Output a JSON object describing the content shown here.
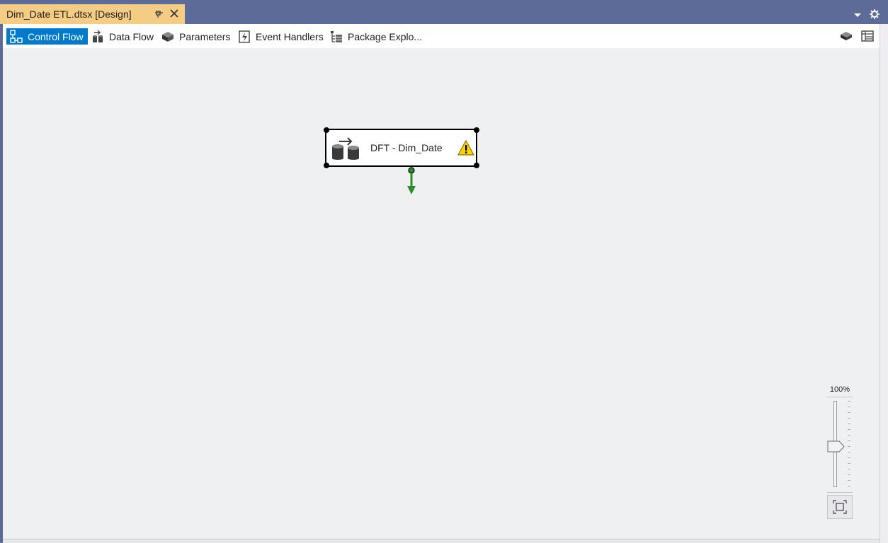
{
  "document_tab": {
    "title": "Dim_Date ETL.dtsx [Design]",
    "pin_icon": "pin-icon",
    "close_icon": "close-icon"
  },
  "window_controls": {
    "dropdown_icon": "chevron-down-icon",
    "settings_icon": "gear-icon"
  },
  "designer_tabs": [
    {
      "label": "Control Flow",
      "icon": "control-flow-icon",
      "active": true
    },
    {
      "label": "Data Flow",
      "icon": "data-flow-icon",
      "active": false
    },
    {
      "label": "Parameters",
      "icon": "parameters-icon",
      "active": false
    },
    {
      "label": "Event Handlers",
      "icon": "event-handlers-icon",
      "active": false
    },
    {
      "label": "Package Explo...",
      "icon": "package-explorer-icon",
      "active": false
    }
  ],
  "toolbar_right": {
    "icons": [
      "variables-icon",
      "properties-icon"
    ]
  },
  "canvas": {
    "task": {
      "label": "DFT - Dim_Date",
      "icon": "data-flow-task-icon",
      "status_icon": "warning-icon"
    }
  },
  "zoom": {
    "label": "100%",
    "fit_icon": "zoom-to-fit-icon"
  },
  "colors": {
    "title_bar": "#5d6b99",
    "doc_tab": "#f5cc84",
    "active_tab": "#007acc",
    "canvas": "#eff0f2",
    "connector": "#2e8b2e"
  }
}
